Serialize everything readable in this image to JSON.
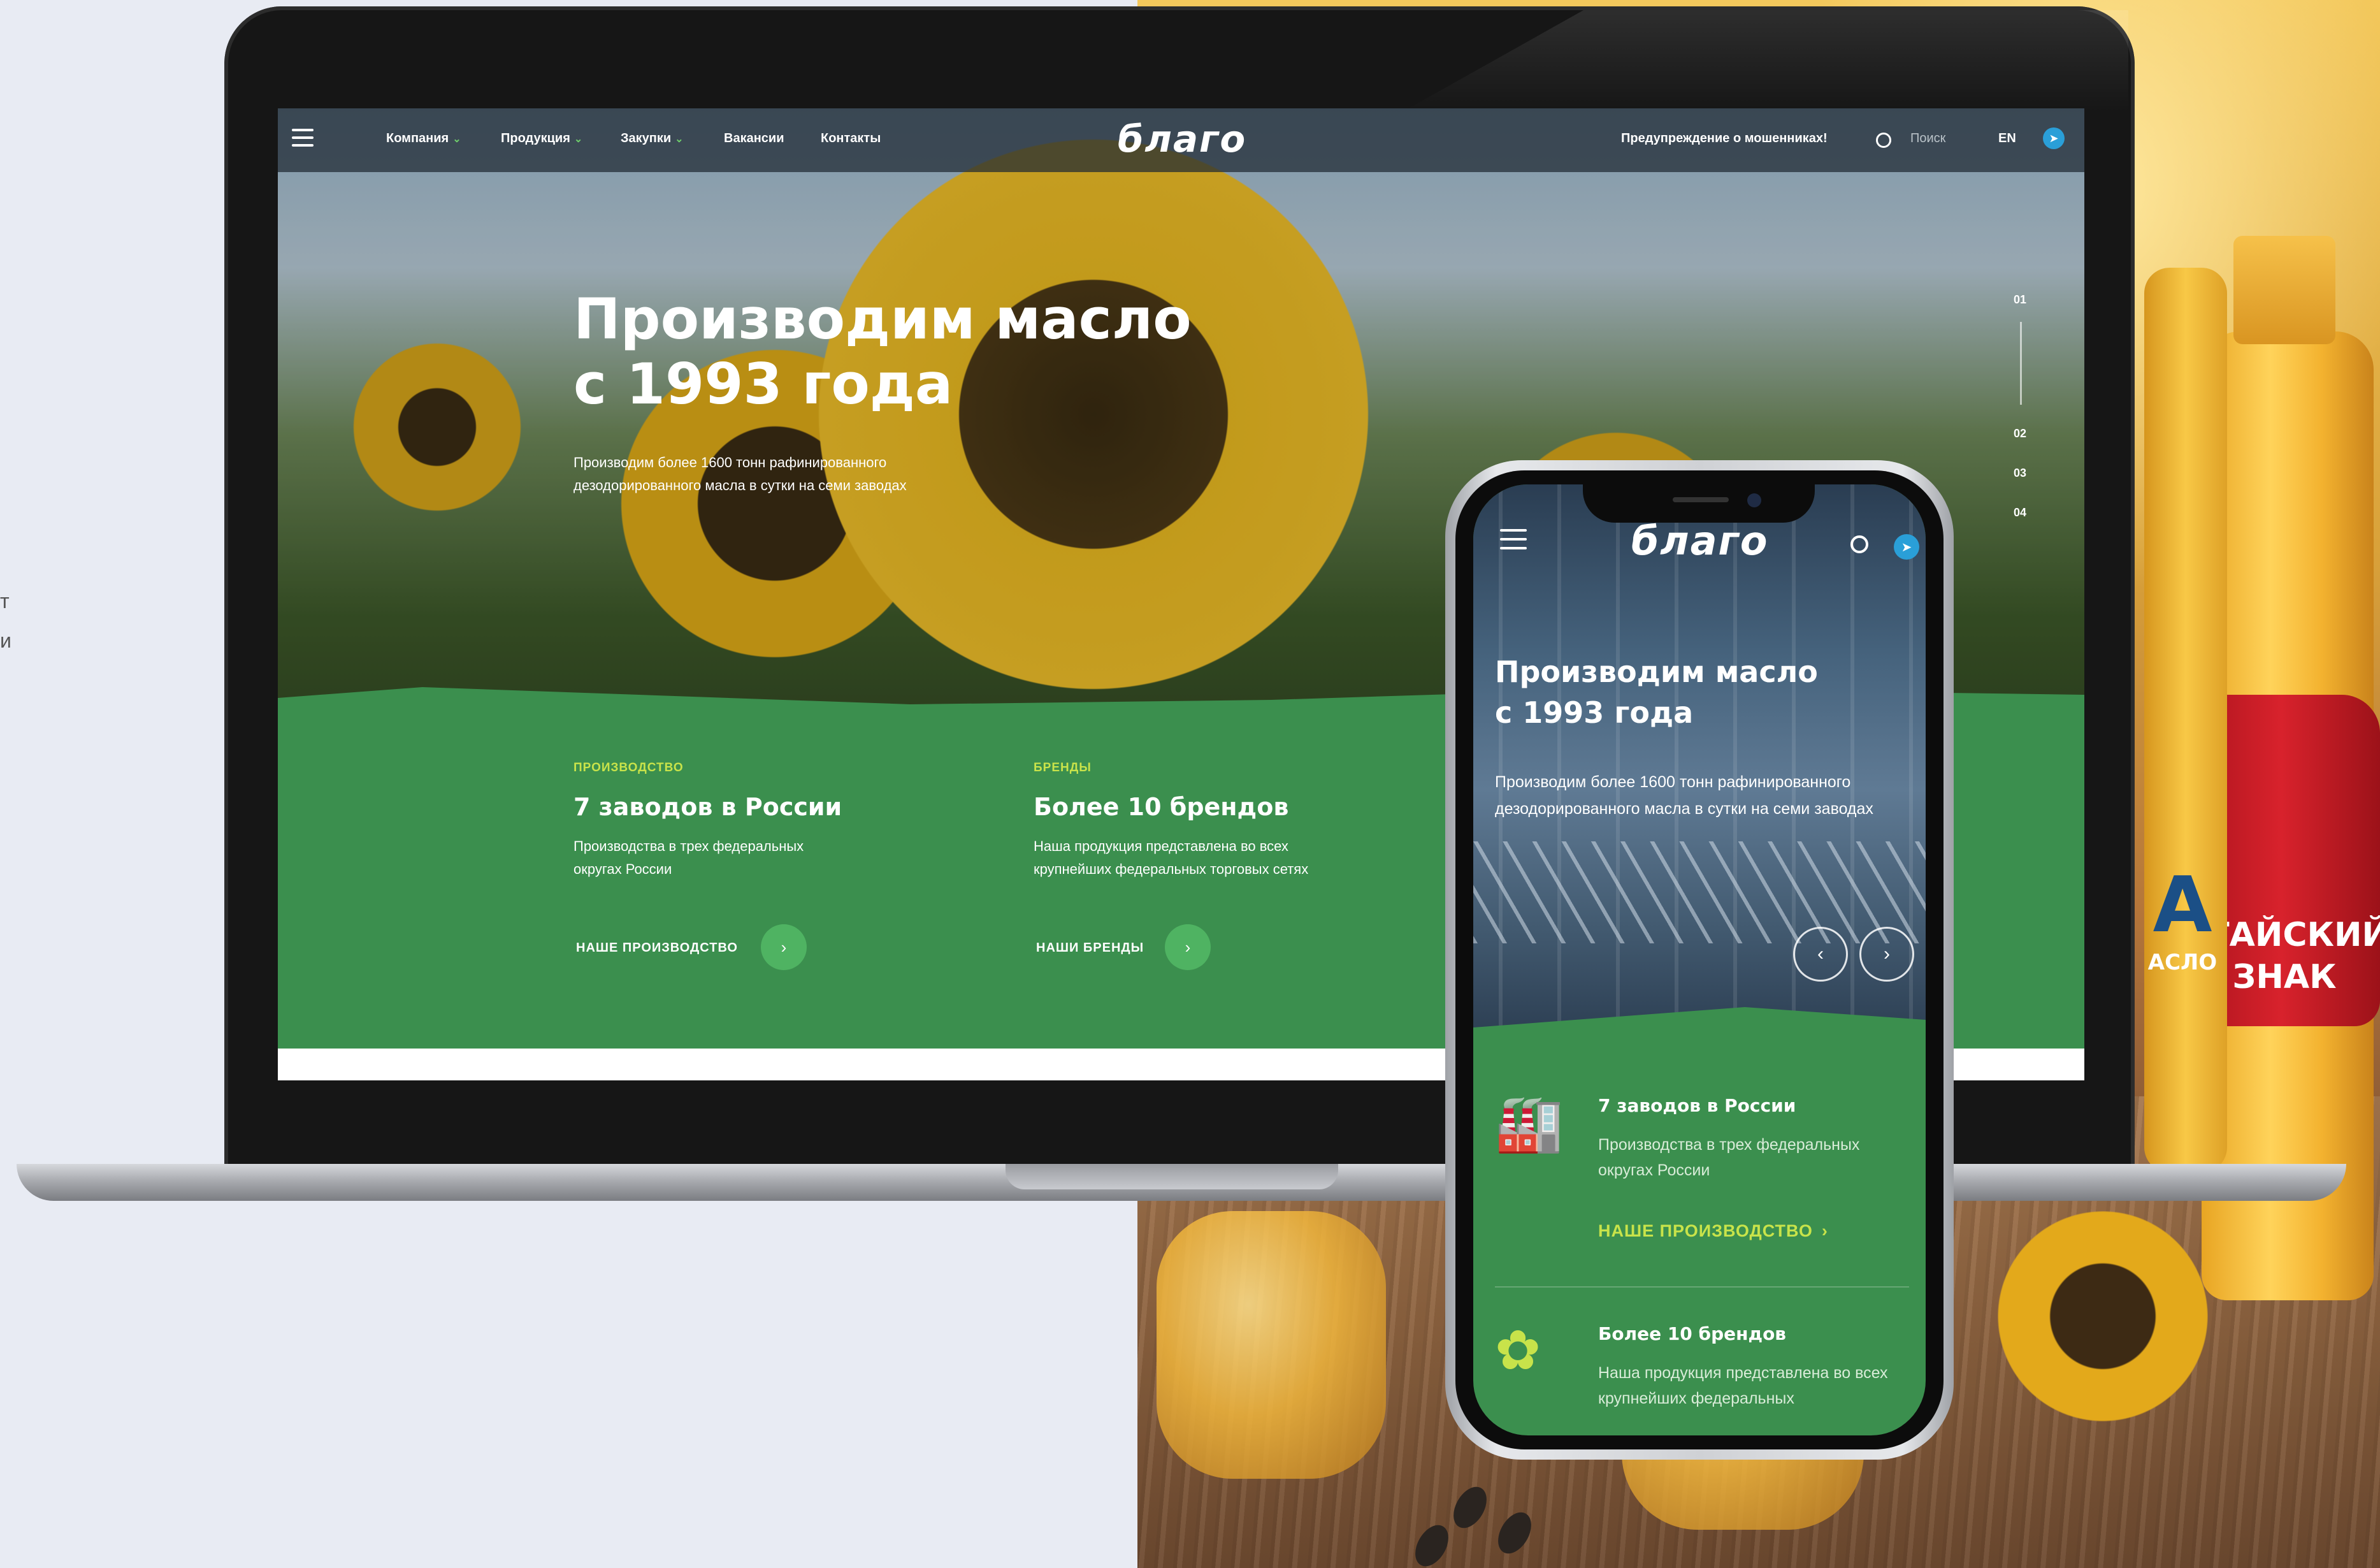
{
  "side_text": "т\nи",
  "desktop": {
    "nav": {
      "items": [
        {
          "label": "Компания",
          "has_dropdown": true
        },
        {
          "label": "Продукция",
          "has_dropdown": true
        },
        {
          "label": "Закупки",
          "has_dropdown": true
        },
        {
          "label": "Вакансии",
          "has_dropdown": false
        },
        {
          "label": "Контакты",
          "has_dropdown": false
        }
      ],
      "logo": "благо",
      "warning": "Предупреждение о мошенниках!",
      "search_placeholder": "Поиск",
      "lang": "EN"
    },
    "hero": {
      "title_line1": "Производим масло",
      "title_line2": "с 1993 года",
      "subtitle": "Производим более 1600 тонн рафинированного дезодорированного масла в сутки на семи заводах",
      "slides": [
        "01",
        "02",
        "03",
        "04"
      ]
    },
    "cards": [
      {
        "category": "ПРОИЗВОДСТВО",
        "title": "7 заводов в России",
        "desc": "Производства в трех федеральных округах России",
        "link": "НАШЕ ПРОИЗВОДСТВО"
      },
      {
        "category": "БРЕНДЫ",
        "title": "Более 10 брендов",
        "desc": "Наша продукция представлена во всех крупнейших федеральных торговых сетях",
        "link": "НАШИ БРЕНДЫ"
      }
    ]
  },
  "mobile": {
    "logo": "благо",
    "title_line1": "Производим масло",
    "title_line2": "с 1993 года",
    "subtitle": "Производим более 1600 тонн рафинированного дезодорированного масла в сутки на семи заводах",
    "items": [
      {
        "title": "7 заводов в России",
        "desc": "Производства в трех федеральных округах России",
        "link": "НАШЕ ПРОИЗВОДСТВО"
      },
      {
        "title": "Более 10 брендов",
        "desc": "Наша продукция представлена во всех крупнейших федеральных"
      }
    ]
  },
  "backdrop": {
    "bottle_labels": [
      "ЛТАЙСКИЙ ЗНАК",
      "А",
      "АСЛО"
    ]
  },
  "colors": {
    "brand_green": "#3b8f4e",
    "accent_lime": "#c8e34a",
    "button_green": "#4fb362",
    "telegram_blue": "#2a9fd8"
  },
  "icons": [
    "menu-icon",
    "search-icon",
    "telegram-icon",
    "chevron-down-icon",
    "chevron-right-icon",
    "chevron-left-icon",
    "factory-icon",
    "sunflower-icon"
  ]
}
